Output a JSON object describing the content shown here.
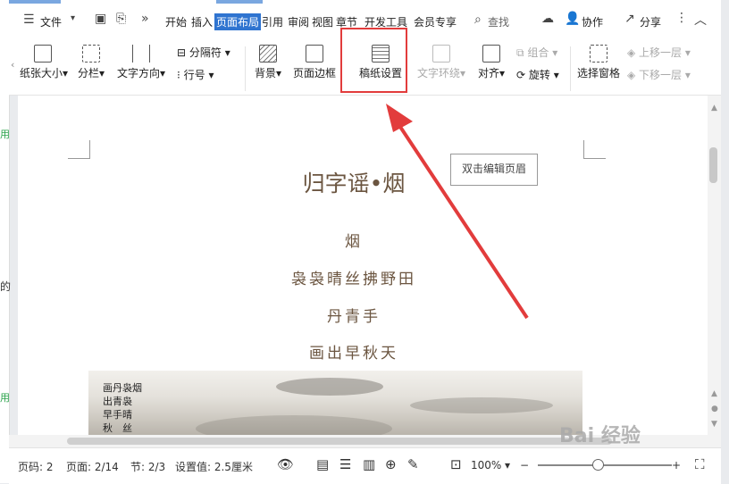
{
  "menu": {
    "file": "文件",
    "tabs": [
      "开始",
      "插入",
      "页面布局",
      "引用",
      "审阅",
      "视图",
      "章节",
      "开发工具",
      "会员专享"
    ],
    "active_tab": "页面布局",
    "search": "查找",
    "collab": "协作",
    "share": "分享"
  },
  "ribbon": {
    "paper_size": "纸张大小",
    "columns": "分栏",
    "text_direction": "文字方向",
    "separator": "分隔符",
    "line_number": "行号",
    "background": "背景",
    "page_border": "页面边框",
    "manuscript": "稿纸设置",
    "text_wrap": "文字环绕",
    "align": "对齐",
    "group": "组合",
    "rotate": "旋转",
    "selection_pane": "选择窗格",
    "move_up": "上移一层",
    "move_down": "下移一层"
  },
  "document": {
    "header_tip": "双击编辑页眉",
    "title": "归字谣•烟",
    "lines": [
      "烟",
      "袅袅晴丝拂野田",
      "丹青手",
      "画出早秋天"
    ],
    "painting_text": "画丹袅烟\n出青袅\n早手晴\n秋　丝"
  },
  "status": {
    "page_num": "页码: 2",
    "pages": "页面: 2/14",
    "section": "节: 2/3",
    "setting": "设置值: 2.5厘米",
    "zoom": "100%"
  },
  "left_strip": {
    "frag1": "用",
    "frag2": "的",
    "frag3": "用"
  },
  "watermark": "Bai 经验",
  "colors": {
    "active_tab": "#2f74d0",
    "highlight": "#e23c3c",
    "poem_text": "#6b5540"
  }
}
